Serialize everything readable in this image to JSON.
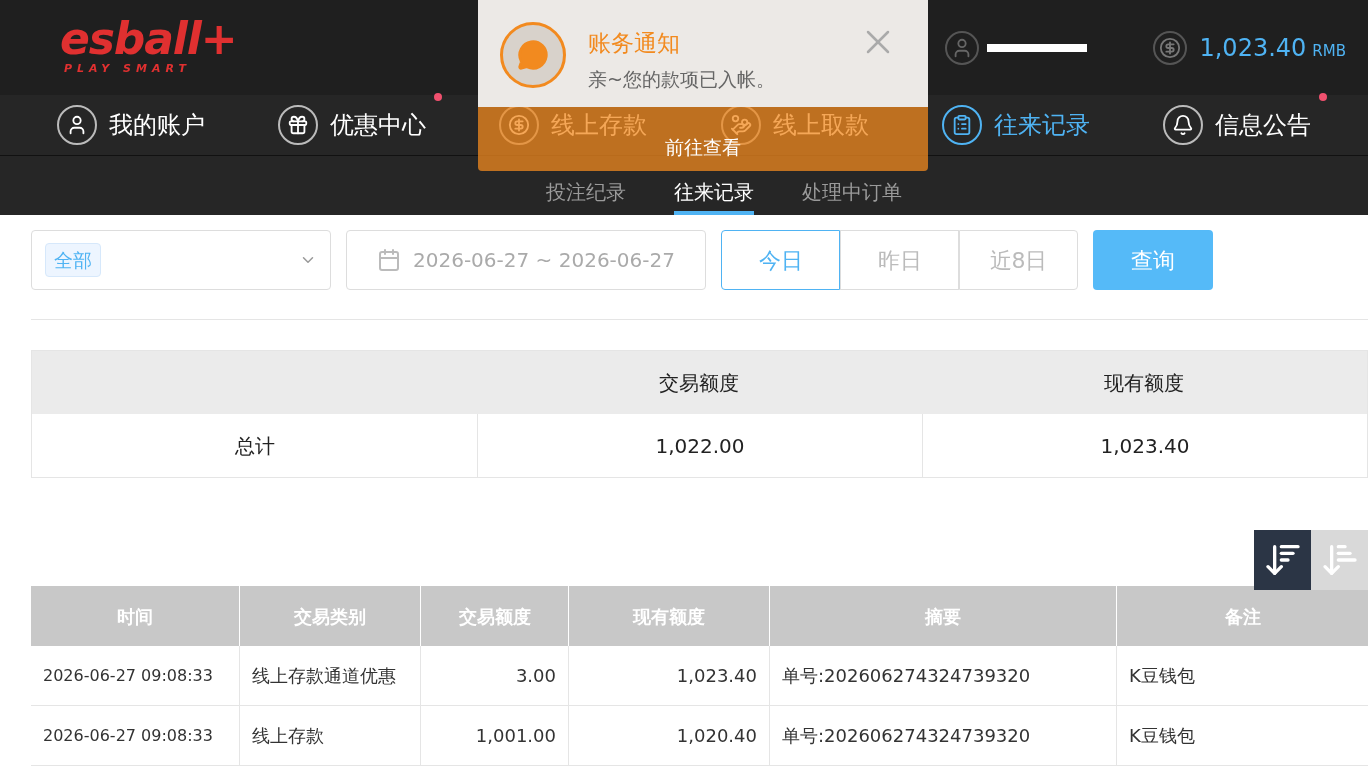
{
  "header": {
    "logo": "esball+",
    "tagline": "PLAY SMART",
    "balance": "1,023.40",
    "currency": "RMB"
  },
  "nav": [
    {
      "label": "我的账户",
      "selected": false,
      "dot": false
    },
    {
      "label": "优惠中心",
      "selected": false,
      "dot": true
    },
    {
      "label": "线上存款",
      "selected": false,
      "dot": false
    },
    {
      "label": "线上取款",
      "selected": false,
      "dot": false
    },
    {
      "label": "往来记录",
      "selected": true,
      "dot": false
    },
    {
      "label": "信息公告",
      "selected": false,
      "dot": true
    }
  ],
  "subtabs": [
    {
      "label": "投注纪录",
      "selected": false
    },
    {
      "label": "往来记录",
      "selected": true
    },
    {
      "label": "处理中订单",
      "selected": false
    }
  ],
  "notification": {
    "title": "账务通知",
    "message": "亲~您的款项已入帐。",
    "button": "前往查看"
  },
  "filters": {
    "type_tag": "全部",
    "date_range": "2026-06-27 ~ 2026-06-27",
    "quick": [
      {
        "label": "今日",
        "selected": true
      },
      {
        "label": "昨日",
        "selected": false
      },
      {
        "label": "近8日",
        "selected": false
      }
    ],
    "search": "查询"
  },
  "summary": {
    "columns": [
      "交易额度",
      "现有额度"
    ],
    "row": [
      "总计",
      "1,022.00",
      "1,023.40"
    ]
  },
  "sort": [
    {
      "kind": "desc",
      "selected": true
    },
    {
      "kind": "asc",
      "selected": false
    }
  ],
  "table": {
    "columns": [
      "时间",
      "交易类别",
      "交易额度",
      "现有额度",
      "摘要",
      "备注"
    ],
    "rows": [
      [
        "2026-06-27 09:08:33",
        "线上存款通道优惠",
        "3.00",
        "1,023.40",
        "单号:202606274324739320",
        "K豆钱包"
      ],
      [
        "2026-06-27 09:08:33",
        "线上存款",
        "1,001.00",
        "1,020.40",
        "单号:202606274324739320",
        "K豆钱包"
      ]
    ]
  }
}
